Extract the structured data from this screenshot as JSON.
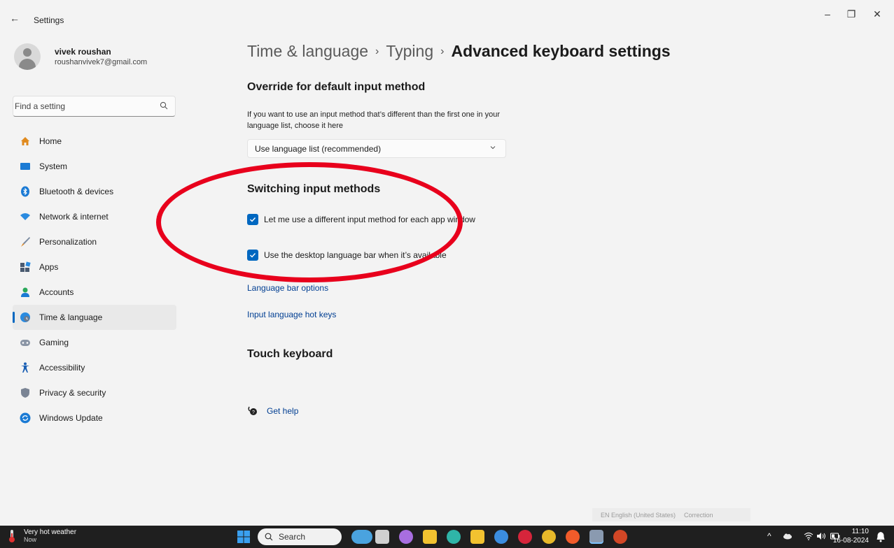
{
  "window": {
    "back_glyph": "←",
    "title": "Settings",
    "minimize_glyph": "–",
    "restore_glyph": "❐",
    "close_glyph": "✕"
  },
  "profile": {
    "name": "vivek roushan",
    "email": "roushanvivek7@gmail.com"
  },
  "search": {
    "placeholder": "Find a setting"
  },
  "nav": [
    {
      "label": "Home",
      "icon": "home-icon",
      "color": "#e08a1e"
    },
    {
      "label": "System",
      "icon": "system-icon",
      "color": "#1a7ad4"
    },
    {
      "label": "Bluetooth & devices",
      "icon": "bluetooth-icon",
      "color": "#1a7ad4"
    },
    {
      "label": "Network & internet",
      "icon": "wifi-icon",
      "color": "#2a8be0"
    },
    {
      "label": "Personalization",
      "icon": "brush-icon",
      "color": "#d9831f"
    },
    {
      "label": "Apps",
      "icon": "apps-icon",
      "color": "#4a5a70"
    },
    {
      "label": "Accounts",
      "icon": "accounts-icon",
      "color": "#2aa85a"
    },
    {
      "label": "Time & language",
      "icon": "globe-clock-icon",
      "color": "#2a8be0",
      "active": true
    },
    {
      "label": "Gaming",
      "icon": "gamepad-icon",
      "color": "#8a95a5"
    },
    {
      "label": "Accessibility",
      "icon": "accessibility-icon",
      "color": "#1a5fb4"
    },
    {
      "label": "Privacy & security",
      "icon": "shield-icon",
      "color": "#7a8494"
    },
    {
      "label": "Windows Update",
      "icon": "update-icon",
      "color": "#1a7ad4"
    }
  ],
  "breadcrumb": {
    "item1": "Time & language",
    "item2": "Typing",
    "current": "Advanced keyboard settings",
    "separator": "›"
  },
  "override": {
    "title": "Override for default input method",
    "description": "If you want to use an input method that’s different than the first one in your language list, choose it here",
    "dropdown_value": "Use language list (recommended)"
  },
  "switching": {
    "title": "Switching input methods",
    "option1": {
      "label": "Let me use a different input method for each app window",
      "checked": true
    },
    "option2": {
      "label": "Use the desktop language bar when it’s available",
      "checked": true
    },
    "link1": "Language bar options",
    "link2": "Input language hot keys"
  },
  "touch": {
    "title": "Touch keyboard"
  },
  "help": {
    "label": "Get help"
  },
  "langbar": {
    "language": "EN English (United States)",
    "correction": "Correction"
  },
  "taskbar": {
    "weather_title": "Very hot weather",
    "weather_sub": "Now",
    "search_label": "Search",
    "time": "11:10",
    "date": "16-08-2024",
    "apps": [
      {
        "icon": "widget-landscape-icon",
        "color": "#4aa3df"
      },
      {
        "icon": "task-view-icon",
        "color": "#d0d0d0"
      },
      {
        "icon": "copilot-icon",
        "color": "#a86ee0"
      },
      {
        "icon": "file-explorer-icon",
        "color": "#f2c230"
      },
      {
        "icon": "edge-icon",
        "color": "#2fb5a8"
      },
      {
        "icon": "store-icon",
        "color": "#f2c230"
      },
      {
        "icon": "chatgpt-icon",
        "color": "#3b8de0"
      },
      {
        "icon": "mcafee-icon",
        "color": "#d6253b"
      },
      {
        "icon": "chrome-icon",
        "color": "#e8b92a"
      },
      {
        "icon": "brave-icon",
        "color": "#f25b2a"
      },
      {
        "icon": "settings-icon",
        "color": "#8a9ab0"
      },
      {
        "icon": "powerpoint-icon",
        "color": "#d24726"
      }
    ],
    "tray_chevron": "^",
    "tray_icons": [
      "cloud-icon",
      "wifi-icon",
      "volume-icon",
      "battery-icon"
    ]
  },
  "colors": {
    "accent": "#0067c0",
    "link": "#003e92",
    "annotation": "#e8001c"
  }
}
